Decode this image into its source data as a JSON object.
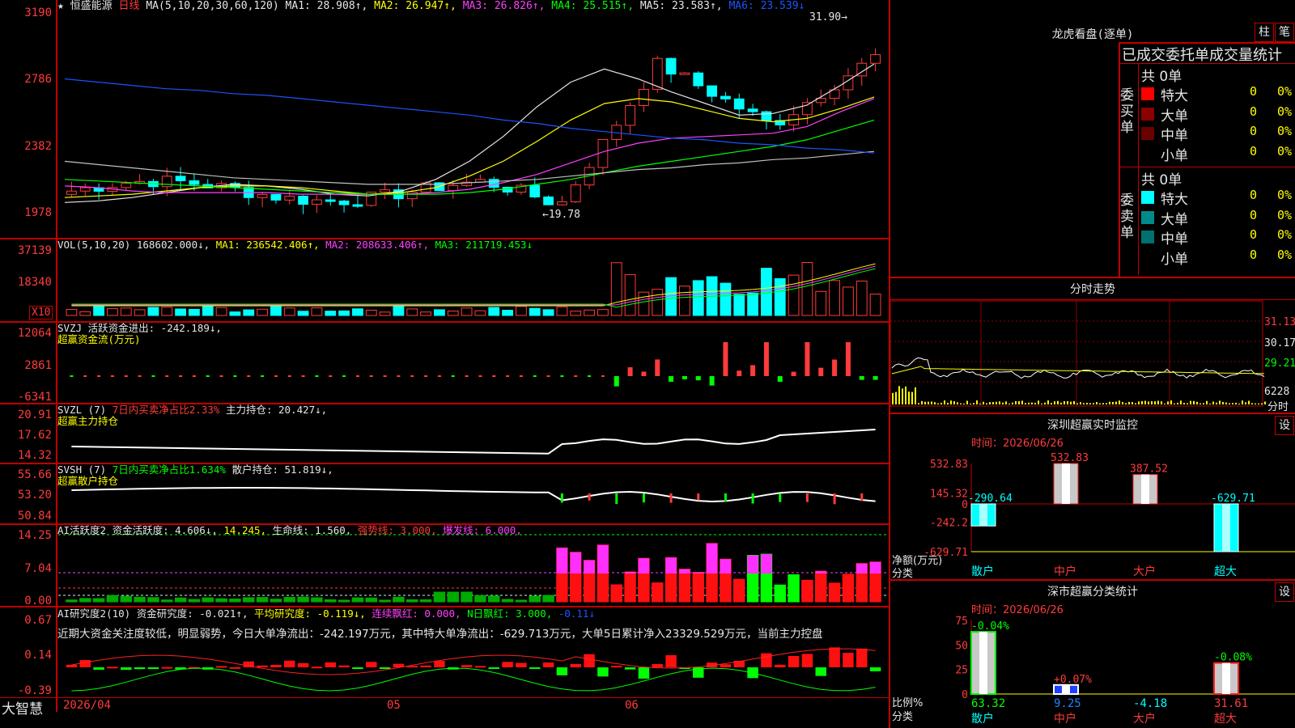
{
  "chart_header": {
    "star": "★",
    "stock_name": "恒盛能源",
    "period": "日线",
    "ma_params": "MA(5,10,20,30,60,120)",
    "ma1": "MA1: 28.908↑,",
    "ma2": "MA2: 26.947↑,",
    "ma3": "MA3: 26.826↑,",
    "ma4": "MA4: 25.515↑,",
    "ma5": "MA5: 23.583↑,",
    "ma6": "MA6: 23.539↓"
  },
  "price_axis": [
    "3190",
    "2786",
    "2382",
    "1978"
  ],
  "price_marks": {
    "high": "31.90",
    "low": "19.78"
  },
  "vol": {
    "label": "VOL(5,10,20)",
    "value": "168602.000↓,",
    "ma1": "MA1: 236542.406↑,",
    "ma2": "MA2: 208633.406↑,",
    "ma3": "MA3: 211719.453↓",
    "axis": [
      "37139",
      "18340"
    ],
    "unit": "X10"
  },
  "svzj": {
    "line1": "SVZJ  活跃资金进出: -242.189↓,",
    "line2": "超赢资金流(万元)",
    "axis": [
      "12064",
      "2861",
      "-6341"
    ]
  },
  "svzl": {
    "name": "SVZL (7)",
    "desc": "7日内买卖净占比2.33%",
    "hold": "主力持仓: 20.427↓,",
    "line2": "超赢主力持仓",
    "axis": [
      "20.91",
      "17.62",
      "14.32"
    ]
  },
  "svsh": {
    "name": "SVSH (7)",
    "desc": "7日内买卖净占比1.634%",
    "hold": "散户持仓: 51.819↓,",
    "line2": "超赢散户持仓",
    "axis": [
      "55.66",
      "53.20",
      "50.84"
    ]
  },
  "ai_active": {
    "name": "AI活跃度2",
    "v1": "资金活跃度: 4.606↓,",
    "v2": "14.245,",
    "v3": "生命线: 1.560,",
    "v4": "强势线: 3.000,",
    "v5": "爆发线: 6.000,",
    "axis": [
      "14.25",
      "7.04",
      "0.00"
    ]
  },
  "ai_research": {
    "name": "AI研究度2(10)",
    "v1": "资金研究度: -0.021↑,",
    "v2": "平均研究度: -0.119↓,",
    "v3": "连续飘红: 0.000,",
    "v4": "N日飘红: 3.000,",
    "v5": "-0.11↓",
    "comment": "近期大资金关注度较低，明显弱势，今日大单净流出：-242.197万元，其中特大单净流出：-629.713万元，大单5日累计净入23329.529万元，当前主力控盘",
    "axis": [
      "0.67",
      "0.14",
      "-0.39"
    ]
  },
  "time_axis": {
    "t1": "2026/04",
    "t2": "05",
    "t3": "06"
  },
  "brand": "大智慧",
  "dragon_tiger": {
    "title": "龙虎看盘(逐单)",
    "btn1": "柱",
    "btn2": "笔",
    "subtitle": "已成交委托单成交量统计",
    "buy_side": "委买单",
    "sell_side": "委卖单",
    "buy_total": "共 0单",
    "sell_total": "共 0单",
    "buy_rows": [
      {
        "label": "特大",
        "count": "0",
        "pct": "0%",
        "color": "#ff0000"
      },
      {
        "label": "大单",
        "count": "0",
        "pct": "0%",
        "color": "#8b0000"
      },
      {
        "label": "中单",
        "count": "0",
        "pct": "0%",
        "color": "#6a0000"
      },
      {
        "label": "小单",
        "count": "0",
        "pct": "0%",
        "color": "#000000"
      }
    ],
    "sell_rows": [
      {
        "label": "特大",
        "count": "0",
        "pct": "0%",
        "color": "#00ffff"
      },
      {
        "label": "大单",
        "count": "0",
        "pct": "0%",
        "color": "#008b8b"
      },
      {
        "label": "中单",
        "count": "0",
        "pct": "0%",
        "color": "#007070"
      },
      {
        "label": "小单",
        "count": "0",
        "pct": "0%",
        "color": "#000000"
      }
    ]
  },
  "intraday": {
    "title": "分时走势",
    "axis": [
      "31.13",
      "30.17",
      "29.21",
      "6228"
    ],
    "foot": "分时"
  },
  "sz_monitor": {
    "title": "深圳超赢实时监控",
    "settings": "设",
    "time": "时间：2026/06/26",
    "axis": [
      "532.83",
      "145.32",
      "0",
      "-242.2",
      "-629.71"
    ],
    "ylabel1": "净额(万元)",
    "ylabel2": "分类",
    "categories": [
      "散户",
      "中户",
      "大户",
      "超大"
    ],
    "values": [
      "-290.64",
      "532.83",
      "387.52",
      "-629.71"
    ]
  },
  "sz_class": {
    "title": "深市超赢分类统计",
    "settings": "设",
    "time": "时间：2026/06/26",
    "axis": [
      "75",
      "50",
      "25",
      "0"
    ],
    "ylabel1": "比例%",
    "ylabel2": "分类",
    "categories": [
      "散户",
      "中户",
      "大户",
      "超大"
    ],
    "changes": [
      "-0.04%",
      "+0.07%",
      "",
      "-0.08%"
    ],
    "values": [
      "63.32",
      "9.25",
      "-4.18",
      "31.61"
    ]
  },
  "chart_data": [
    {
      "type": "line",
      "title": "恒盛能源 日线",
      "ylim": [
        19.78,
        31.9
      ],
      "series": [
        {
          "name": "MA1",
          "values": [
            20.5,
            20.6,
            20.8,
            21.1,
            21.4,
            21.6,
            21.5,
            21.3,
            21.0,
            20.9,
            21.2,
            21.9,
            23.0,
            24.5,
            26.3,
            27.8,
            28.6,
            28.0,
            27.2,
            26.5,
            25.8,
            25.9,
            26.4,
            27.6,
            28.9
          ]
        },
        {
          "name": "MA2",
          "values": [
            20.8,
            20.9,
            21.0,
            21.2,
            21.4,
            21.5,
            21.5,
            21.4,
            21.2,
            21.0,
            21.1,
            21.4,
            22.1,
            23.0,
            24.2,
            25.5,
            26.5,
            26.8,
            26.6,
            26.1,
            25.6,
            25.4,
            25.6,
            26.2,
            26.9
          ]
        },
        {
          "name": "MA3",
          "values": [
            21.5,
            21.4,
            21.2,
            21.1,
            21.1,
            21.1,
            21.1,
            21.0,
            21.0,
            21.0,
            21.0,
            21.1,
            21.3,
            21.7,
            22.2,
            22.9,
            23.6,
            24.1,
            24.4,
            24.5,
            24.6,
            24.7,
            25.1,
            26.0,
            26.8
          ]
        },
        {
          "name": "MA4",
          "values": [
            21.9,
            21.8,
            21.7,
            21.6,
            21.5,
            21.4,
            21.3,
            21.2,
            21.1,
            21.0,
            21.0,
            21.0,
            21.1,
            21.3,
            21.6,
            21.9,
            22.3,
            22.7,
            23.0,
            23.3,
            23.6,
            23.9,
            24.3,
            24.9,
            25.5
          ]
        },
        {
          "name": "MA5",
          "values": [
            23.0,
            22.8,
            22.6,
            22.4,
            22.2,
            22.0,
            21.9,
            21.8,
            21.7,
            21.6,
            21.6,
            21.6,
            21.7,
            21.8,
            21.9,
            22.1,
            22.3,
            22.5,
            22.6,
            22.8,
            22.9,
            23.1,
            23.2,
            23.4,
            23.6
          ]
        },
        {
          "name": "MA6",
          "values": [
            28.0,
            27.8,
            27.6,
            27.4,
            27.3,
            27.1,
            27.0,
            26.8,
            26.6,
            26.4,
            26.2,
            26.0,
            25.8,
            25.5,
            25.3,
            25.0,
            24.8,
            24.6,
            24.4,
            24.3,
            24.1,
            24.0,
            23.8,
            23.7,
            23.5
          ]
        }
      ]
    },
    {
      "type": "bar",
      "title": "深圳超赢实时监控",
      "categories": [
        "散户",
        "中户",
        "大户",
        "超大"
      ],
      "values": [
        -290.64,
        532.83,
        387.52,
        -629.71
      ],
      "ylim": [
        -629.71,
        532.83
      ]
    },
    {
      "type": "bar",
      "title": "深市超赢分类统计",
      "categories": [
        "散户",
        "中户",
        "大户",
        "超大"
      ],
      "values": [
        63.32,
        9.25,
        -4.18,
        31.61
      ],
      "ylim": [
        0,
        75
      ]
    }
  ]
}
